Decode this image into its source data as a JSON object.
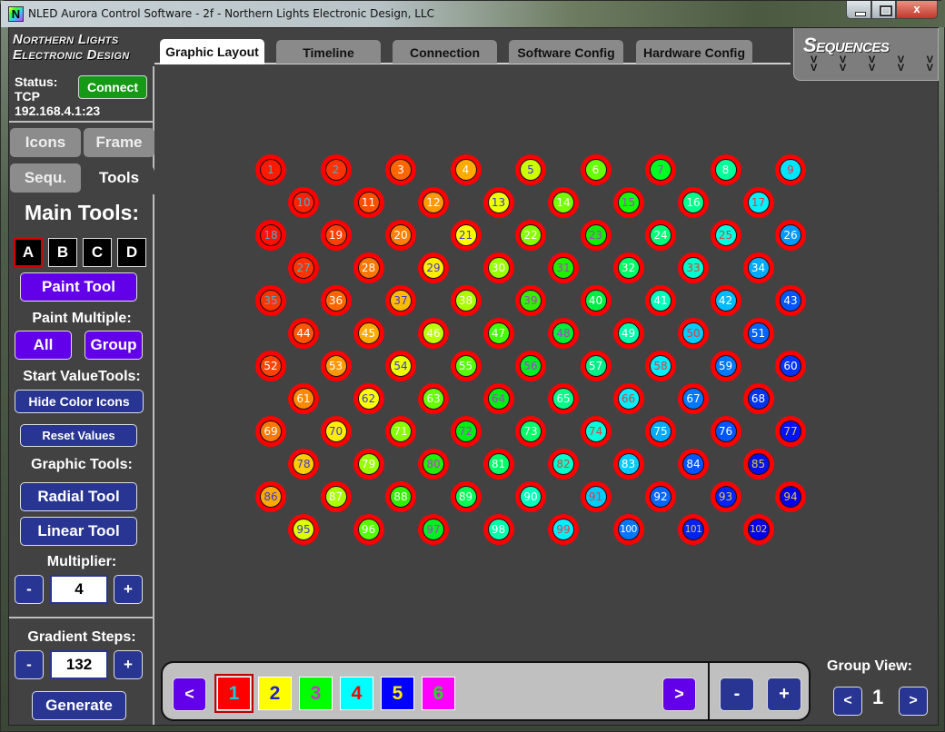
{
  "window": {
    "title": "NLED Aurora Control Software - 2f - Northern Lights Electronic Design, LLC",
    "app_icon": "N",
    "controls": {
      "minimize": "minimize-icon",
      "maximize": "maximize-icon",
      "close": "x"
    }
  },
  "header": {
    "logo_line1": "Northern Lights",
    "logo_line2": "Electronic Design",
    "tabs": [
      {
        "label": "Graphic Layout",
        "active": true
      },
      {
        "label": "Timeline",
        "active": false
      },
      {
        "label": "Connection",
        "active": false
      },
      {
        "label": "Software Config",
        "active": false
      },
      {
        "label": "Hardware Config",
        "active": false
      }
    ],
    "sequences_title": "Sequences",
    "sequences_arrow": "V"
  },
  "left": {
    "status_label": "Status:",
    "status_protocol": "TCP",
    "status_address": "192.168.4.1:23",
    "connect_label": "Connect",
    "tabs": [
      {
        "label": "Icons",
        "active": false
      },
      {
        "label": "Frame",
        "active": false
      },
      {
        "label": "Sequ.",
        "active": false
      },
      {
        "label": "Tools",
        "active": true
      }
    ],
    "main_tools_heading": "Main Tools:",
    "tool_slots": [
      {
        "label": "A",
        "selected": true
      },
      {
        "label": "B",
        "selected": false
      },
      {
        "label": "C",
        "selected": false
      },
      {
        "label": "D",
        "selected": false
      }
    ],
    "paint_tool_label": "Paint Tool",
    "paint_multiple_heading": "Paint Multiple:",
    "all_label": "All",
    "group_label": "Group",
    "start_value_heading": "Start ValueTools:",
    "hide_color_icons_label": "Hide Color Icons",
    "reset_values_label": "Reset Values",
    "graphic_tools_heading": "Graphic Tools:",
    "radial_tool_label": "Radial Tool",
    "linear_tool_label": "Linear Tool",
    "multiplier_heading": "Multiplier:",
    "multiplier_value": "4",
    "minus": "-",
    "plus": "+",
    "gradient_steps_heading": "Gradient Steps:",
    "gradient_steps_value": "132",
    "generate_label": "Generate"
  },
  "grid": {
    "ring_color": "#ff0000",
    "leds": [
      {
        "n": "1",
        "bg": "#ff1a00",
        "fg": "#3cb4d2"
      },
      {
        "n": "2",
        "bg": "#ff3300",
        "fg": "#3cb4d2"
      },
      {
        "n": "3",
        "bg": "#ff6600",
        "fg": "#ffffff"
      },
      {
        "n": "4",
        "bg": "#ffaa00",
        "fg": "#ffffff"
      },
      {
        "n": "5",
        "bg": "#ccff00",
        "fg": "#3a3adc"
      },
      {
        "n": "6",
        "bg": "#66ff00",
        "fg": "#ffffff"
      },
      {
        "n": "7",
        "bg": "#00ff22",
        "fg": "#b040d0"
      },
      {
        "n": "8",
        "bg": "#00ff99",
        "fg": "#ffffff"
      },
      {
        "n": "9",
        "bg": "#00e5ff",
        "fg": "#e04040"
      },
      {
        "n": "10",
        "bg": "#ff2200",
        "fg": "#3cb4d2"
      },
      {
        "n": "11",
        "bg": "#ff4d00",
        "fg": "#ffffff"
      },
      {
        "n": "12",
        "bg": "#ff9900",
        "fg": "#ffffff"
      },
      {
        "n": "13",
        "bg": "#eeff00",
        "fg": "#3a3adc"
      },
      {
        "n": "14",
        "bg": "#77ff00",
        "fg": "#ffffff"
      },
      {
        "n": "15",
        "bg": "#11ff00",
        "fg": "#b040d0"
      },
      {
        "n": "16",
        "bg": "#00ff88",
        "fg": "#ffffff"
      },
      {
        "n": "17",
        "bg": "#00f0ff",
        "fg": "#e04040"
      },
      {
        "n": "18",
        "bg": "#ff1100",
        "fg": "#3cb4d2"
      },
      {
        "n": "19",
        "bg": "#ff4000",
        "fg": "#ffffff"
      },
      {
        "n": "20",
        "bg": "#ff8000",
        "fg": "#ffffff"
      },
      {
        "n": "21",
        "bg": "#ffff00",
        "fg": "#3a3adc"
      },
      {
        "n": "22",
        "bg": "#88ff00",
        "fg": "#ffffff"
      },
      {
        "n": "23",
        "bg": "#11ee00",
        "fg": "#b040d0"
      },
      {
        "n": "24",
        "bg": "#00ff77",
        "fg": "#ffffff"
      },
      {
        "n": "25",
        "bg": "#00ffe0",
        "fg": "#e04040"
      },
      {
        "n": "26",
        "bg": "#0099ff",
        "fg": "#ffffff"
      },
      {
        "n": "27",
        "bg": "#ff3300",
        "fg": "#3cb4d2"
      },
      {
        "n": "28",
        "bg": "#ff7700",
        "fg": "#ffffff"
      },
      {
        "n": "29",
        "bg": "#ffee00",
        "fg": "#3a3adc"
      },
      {
        "n": "30",
        "bg": "#99ff00",
        "fg": "#ffffff"
      },
      {
        "n": "31",
        "bg": "#22ee00",
        "fg": "#b040d0"
      },
      {
        "n": "32",
        "bg": "#00ff66",
        "fg": "#ffffff"
      },
      {
        "n": "33",
        "bg": "#00ffcc",
        "fg": "#e04040"
      },
      {
        "n": "34",
        "bg": "#00aaff",
        "fg": "#ffffff"
      },
      {
        "n": "35",
        "bg": "#ff3300",
        "fg": "#3cb4d2"
      },
      {
        "n": "36",
        "bg": "#ff6600",
        "fg": "#ffffff"
      },
      {
        "n": "37",
        "bg": "#ffbb00",
        "fg": "#3a3adc"
      },
      {
        "n": "38",
        "bg": "#aaff00",
        "fg": "#ffffff"
      },
      {
        "n": "39",
        "bg": "#33ee00",
        "fg": "#b040d0"
      },
      {
        "n": "40",
        "bg": "#00ee44",
        "fg": "#ffffff"
      },
      {
        "n": "41",
        "bg": "#00ffbb",
        "fg": "#ffffff"
      },
      {
        "n": "42",
        "bg": "#00bbff",
        "fg": "#ffffff"
      },
      {
        "n": "43",
        "bg": "#0055ff",
        "fg": "#ffffff"
      },
      {
        "n": "44",
        "bg": "#ff5500",
        "fg": "#ffffff"
      },
      {
        "n": "45",
        "bg": "#ffaa00",
        "fg": "#ffffff"
      },
      {
        "n": "46",
        "bg": "#bbff00",
        "fg": "#ffffff"
      },
      {
        "n": "47",
        "bg": "#44ff00",
        "fg": "#ffffff"
      },
      {
        "n": "48",
        "bg": "#00ee33",
        "fg": "#b040d0"
      },
      {
        "n": "49",
        "bg": "#00ffaa",
        "fg": "#ffffff"
      },
      {
        "n": "50",
        "bg": "#00ccff",
        "fg": "#e04040"
      },
      {
        "n": "51",
        "bg": "#0066ff",
        "fg": "#ffffff"
      },
      {
        "n": "52",
        "bg": "#ff4400",
        "fg": "#ffffff"
      },
      {
        "n": "53",
        "bg": "#ff9900",
        "fg": "#ffffff"
      },
      {
        "n": "54",
        "bg": "#eeff00",
        "fg": "#3a3adc"
      },
      {
        "n": "55",
        "bg": "#55ff00",
        "fg": "#ffffff"
      },
      {
        "n": "56",
        "bg": "#00ee22",
        "fg": "#b040d0"
      },
      {
        "n": "57",
        "bg": "#00ee88",
        "fg": "#ffffff"
      },
      {
        "n": "58",
        "bg": "#00eeff",
        "fg": "#e04040"
      },
      {
        "n": "59",
        "bg": "#0077ff",
        "fg": "#ffffff"
      },
      {
        "n": "60",
        "bg": "#0033ff",
        "fg": "#ffffff"
      },
      {
        "n": "61",
        "bg": "#ff8800",
        "fg": "#ffffff"
      },
      {
        "n": "62",
        "bg": "#ffff00",
        "fg": "#3a3adc"
      },
      {
        "n": "63",
        "bg": "#66ff00",
        "fg": "#ffffff"
      },
      {
        "n": "64",
        "bg": "#00ee11",
        "fg": "#b040d0"
      },
      {
        "n": "65",
        "bg": "#00ff88",
        "fg": "#ffffff"
      },
      {
        "n": "66",
        "bg": "#00f0ff",
        "fg": "#e04040"
      },
      {
        "n": "67",
        "bg": "#0077ff",
        "fg": "#ffffff"
      },
      {
        "n": "68",
        "bg": "#0033ee",
        "fg": "#ffffff"
      },
      {
        "n": "69",
        "bg": "#ff7700",
        "fg": "#ffffff"
      },
      {
        "n": "70",
        "bg": "#ffee00",
        "fg": "#3a3adc"
      },
      {
        "n": "71",
        "bg": "#88ff00",
        "fg": "#ffffff"
      },
      {
        "n": "72",
        "bg": "#00ee11",
        "fg": "#b040d0"
      },
      {
        "n": "73",
        "bg": "#00ff66",
        "fg": "#ffffff"
      },
      {
        "n": "74",
        "bg": "#00ffdd",
        "fg": "#e04040"
      },
      {
        "n": "75",
        "bg": "#00aaff",
        "fg": "#ffffff"
      },
      {
        "n": "76",
        "bg": "#0055ff",
        "fg": "#ffffff"
      },
      {
        "n": "77",
        "bg": "#0011ff",
        "fg": "#e6c840"
      },
      {
        "n": "78",
        "bg": "#ffcc00",
        "fg": "#3a3adc"
      },
      {
        "n": "79",
        "bg": "#99ff00",
        "fg": "#ffffff"
      },
      {
        "n": "80",
        "bg": "#22ee00",
        "fg": "#b040d0"
      },
      {
        "n": "81",
        "bg": "#00ff66",
        "fg": "#ffffff"
      },
      {
        "n": "82",
        "bg": "#00ffcc",
        "fg": "#e04040"
      },
      {
        "n": "83",
        "bg": "#00ccff",
        "fg": "#ffffff"
      },
      {
        "n": "84",
        "bg": "#0055ff",
        "fg": "#ffffff"
      },
      {
        "n": "85",
        "bg": "#0011ee",
        "fg": "#e6c840"
      },
      {
        "n": "86",
        "bg": "#ffaa00",
        "fg": "#3a3adc"
      },
      {
        "n": "87",
        "bg": "#aaff00",
        "fg": "#ffffff"
      },
      {
        "n": "88",
        "bg": "#33ee00",
        "fg": "#ffffff"
      },
      {
        "n": "89",
        "bg": "#00ff55",
        "fg": "#ffffff"
      },
      {
        "n": "90",
        "bg": "#00ffbb",
        "fg": "#ffffff"
      },
      {
        "n": "91",
        "bg": "#00ccff",
        "fg": "#e04040"
      },
      {
        "n": "92",
        "bg": "#0066ff",
        "fg": "#ffffff"
      },
      {
        "n": "93",
        "bg": "#0022ff",
        "fg": "#e6c840"
      },
      {
        "n": "94",
        "bg": "#0000ee",
        "fg": "#e6c840"
      },
      {
        "n": "95",
        "bg": "#ddff00",
        "fg": "#3a3adc"
      },
      {
        "n": "96",
        "bg": "#55ff00",
        "fg": "#ffffff"
      },
      {
        "n": "97",
        "bg": "#00ee22",
        "fg": "#b040d0"
      },
      {
        "n": "98",
        "bg": "#00ffaa",
        "fg": "#ffffff"
      },
      {
        "n": "99",
        "bg": "#00eeff",
        "fg": "#e04040"
      },
      {
        "n": "100",
        "bg": "#0077ff",
        "fg": "#ffffff"
      },
      {
        "n": "101",
        "bg": "#0022ee",
        "fg": "#e6c840"
      },
      {
        "n": "102",
        "bg": "#0000ee",
        "fg": "#e6c840"
      }
    ]
  },
  "palette": {
    "prev": "<",
    "next": ">",
    "swatches": [
      {
        "label": "1",
        "bg": "#ff0000",
        "fg": "#1ec8d8",
        "selected": true
      },
      {
        "label": "2",
        "bg": "#ffff00",
        "fg": "#2222cc",
        "selected": false
      },
      {
        "label": "3",
        "bg": "#00ff00",
        "fg": "#cc33cc",
        "selected": false
      },
      {
        "label": "4",
        "bg": "#00ffff",
        "fg": "#ff0000",
        "selected": false
      },
      {
        "label": "5",
        "bg": "#0000ff",
        "fg": "#ffee00",
        "selected": false
      },
      {
        "label": "6",
        "bg": "#ff00ff",
        "fg": "#22dd22",
        "selected": false
      }
    ],
    "minus": "-",
    "plus": "+"
  },
  "group_view": {
    "label": "Group View:",
    "prev": "<",
    "value": "1",
    "next": ">"
  }
}
